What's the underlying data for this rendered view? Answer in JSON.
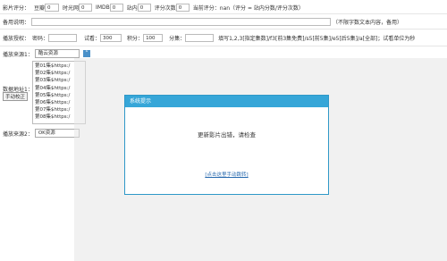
{
  "rating": {
    "label": "影片评分：",
    "douban_label": "豆瓣",
    "douban_value": "0",
    "mtime_label": "时光网",
    "mtime_value": "0",
    "imdb_label": "IMDB",
    "imdb_value": "0",
    "site_label": "站内",
    "site_value": "0",
    "count_label": "评分次数",
    "count_value": "0",
    "current_label": "当前评分：nan（评分 = 站内分数/评分次数）"
  },
  "memo": {
    "label": "备用说明：",
    "value": "",
    "hint": "（不限字数文本内容，备用）"
  },
  "perm": {
    "label": "播放授权：",
    "pwd_label": "密码：",
    "pwd_value": "",
    "trial_label": "试看：",
    "trial_value": "300",
    "points_label": "积分：",
    "points_value": "100",
    "episodes_label": "分集：",
    "episodes_value": "",
    "hint": "填写1,2,3[指定集数]/f3[前3集免费]/s5[前5集]/e5[后5集]/a[全部]；试看单位为秒"
  },
  "source1": {
    "label": "播放来源1：",
    "select": "酷云资源"
  },
  "addr1": {
    "label": "数据地址1：",
    "button": "手动校正",
    "lines": [
      "第01集$https:/",
      "第02集$https:/",
      "第03集$https:/",
      "第04集$https:/",
      "第05集$https:/",
      "第06集$https:/",
      "第07集$https:/",
      "第08集$https:/"
    ]
  },
  "source2": {
    "label": "播放来源2：",
    "select": "OK资源"
  },
  "dialog": {
    "title": "系统提示",
    "message": "更新影片出错，请检查",
    "link": "[点击这里手动跳转]"
  },
  "colors": {
    "dialog_border": "#2f98c8",
    "dialog_header": "#36a6d8",
    "link": "#2b6cb0"
  }
}
